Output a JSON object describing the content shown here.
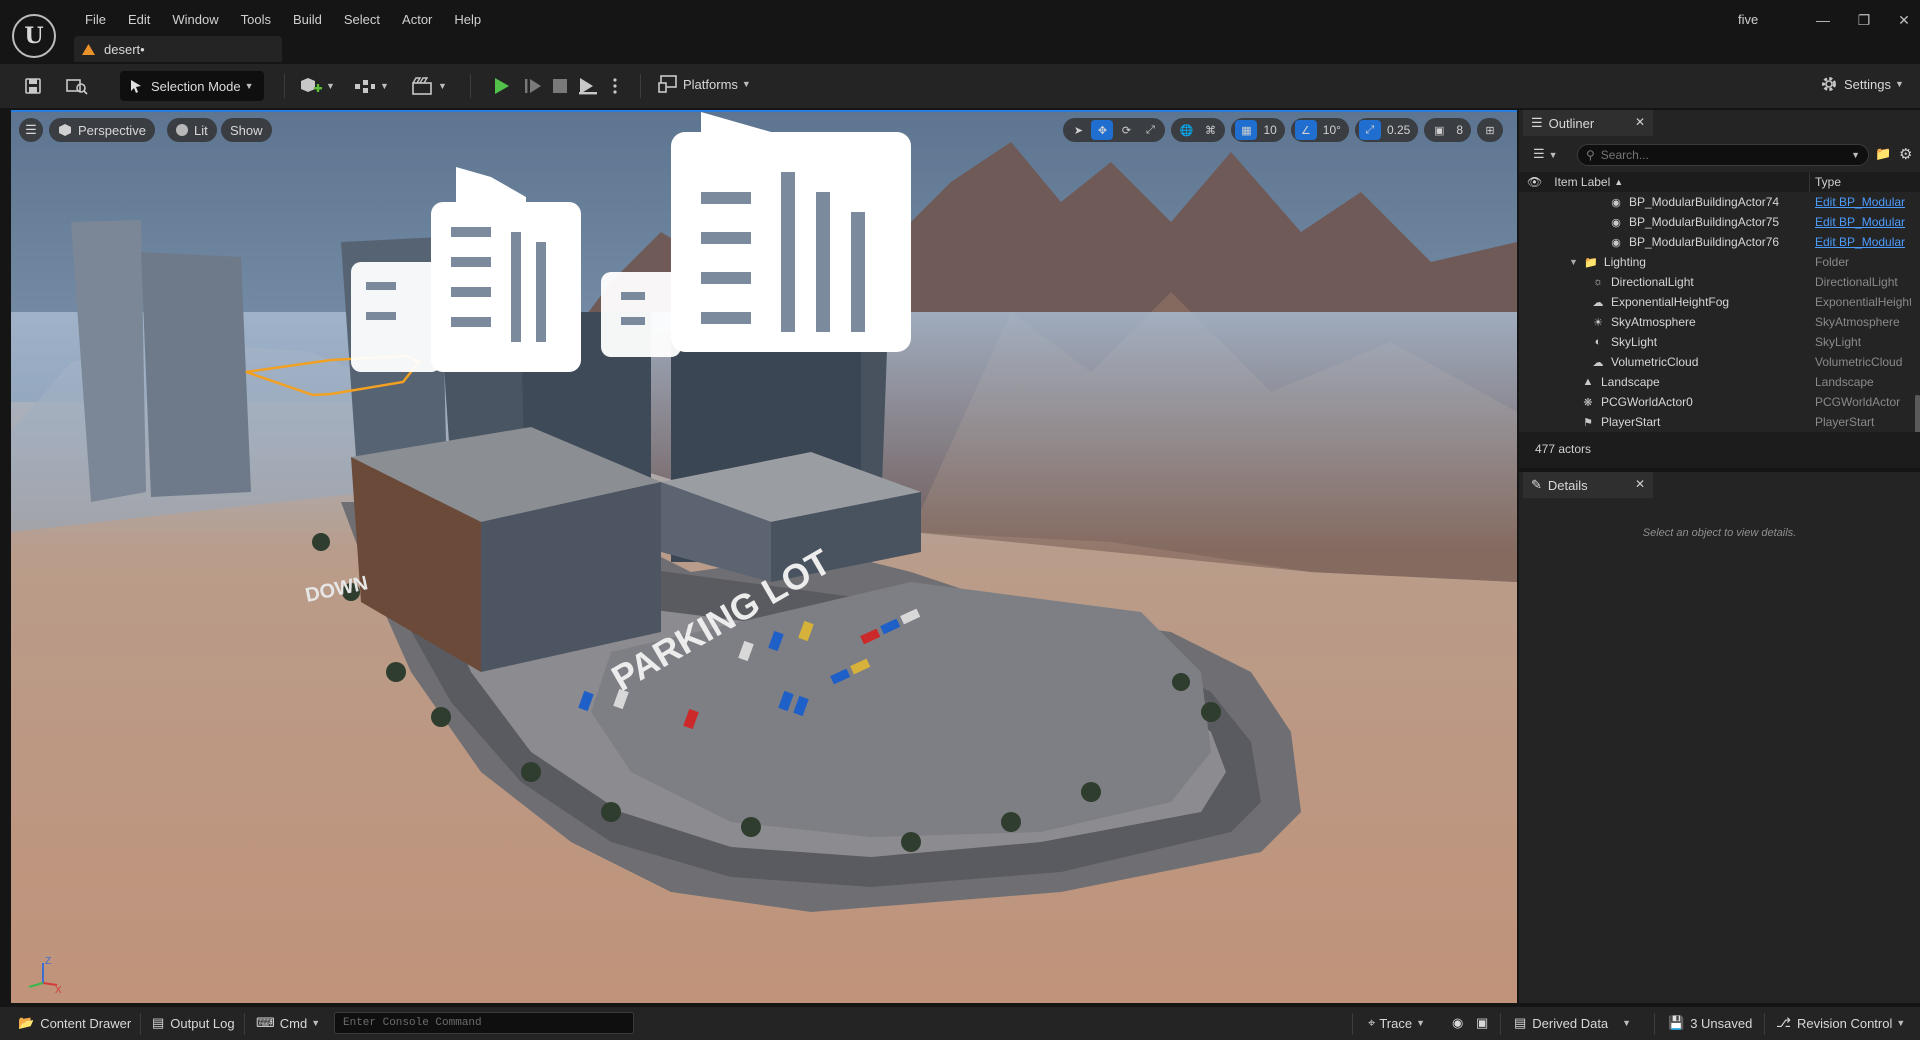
{
  "menu": [
    "File",
    "Edit",
    "Window",
    "Tools",
    "Build",
    "Select",
    "Actor",
    "Help"
  ],
  "project_tab": "desert•",
  "project_name": "five",
  "toolbar": {
    "mode_label": "Selection Mode",
    "platforms_label": "Platforms",
    "settings_label": "Settings"
  },
  "viewport": {
    "perspective_label": "Perspective",
    "lit_label": "Lit",
    "show_label": "Show",
    "grid_snap": "10",
    "rotation_snap": "10°",
    "scale_snap": "0.25",
    "camera_speed": "8",
    "overlay_text_left": "DOWN",
    "overlay_text_parking": "PARKING LOT",
    "axis_x": "X",
    "axis_z": "Z"
  },
  "outliner": {
    "tab_label": "Outliner",
    "search_placeholder": "Search...",
    "col_item_label": "Item Label",
    "col_type": "Type",
    "rows": [
      {
        "label": "BP_ModularBuildingActor74",
        "type": "Edit BP_Modular",
        "link": true
      },
      {
        "label": "BP_ModularBuildingActor75",
        "type": "Edit BP_Modular",
        "link": true
      },
      {
        "label": "BP_ModularBuildingActor76",
        "type": "Edit BP_Modular",
        "link": true
      },
      {
        "label": "Lighting",
        "type": "Folder",
        "link": false
      },
      {
        "label": "DirectionalLight",
        "type": "DirectionalLight",
        "link": false
      },
      {
        "label": "ExponentialHeightFog",
        "type": "ExponentialHeightFog",
        "link": false
      },
      {
        "label": "SkyAtmosphere",
        "type": "SkyAtmosphere",
        "link": false
      },
      {
        "label": "SkyLight",
        "type": "SkyLight",
        "link": false
      },
      {
        "label": "VolumetricCloud",
        "type": "VolumetricCloud",
        "link": false
      },
      {
        "label": "Landscape",
        "type": "Landscape",
        "link": false
      },
      {
        "label": "PCGWorldActor0",
        "type": "PCGWorldActor",
        "link": false
      },
      {
        "label": "PlayerStart",
        "type": "PlayerStart",
        "link": false
      }
    ],
    "actor_count": "477 actors"
  },
  "details": {
    "tab_label": "Details",
    "empty_message": "Select an object to view details."
  },
  "statusbar": {
    "content_drawer": "Content Drawer",
    "output_log": "Output Log",
    "cmd": "Cmd",
    "console_placeholder": "Enter Console Command",
    "trace": "Trace",
    "derived_data": "Derived Data",
    "unsaved": "3 Unsaved",
    "revision_control": "Revision Control"
  }
}
